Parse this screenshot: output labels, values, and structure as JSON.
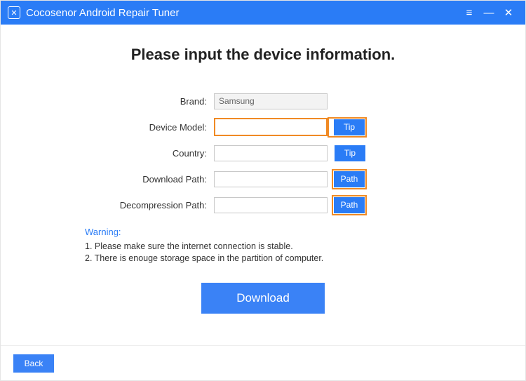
{
  "titlebar": {
    "app_name": "Cocosenor Android Repair Tuner",
    "menu_glyph": "≡",
    "minimize_glyph": "—",
    "close_glyph": "✕",
    "logo_glyph": "✕"
  },
  "page": {
    "heading": "Please input the device information."
  },
  "form": {
    "brand": {
      "label": "Brand:",
      "value": "Samsung"
    },
    "device_model": {
      "label": "Device Model:",
      "value": "",
      "button": "Tip"
    },
    "country": {
      "label": "Country:",
      "value": "",
      "button": "Tip"
    },
    "download_path": {
      "label": "Download Path:",
      "value": "",
      "button": "Path"
    },
    "decompression_path": {
      "label": "Decompression Path:",
      "value": "",
      "button": "Path"
    }
  },
  "warning": {
    "title": "Warning:",
    "line1": "1. Please make sure the internet connection is stable.",
    "line2": "2. There is enouge storage space in the partition of computer."
  },
  "actions": {
    "download": "Download",
    "back": "Back"
  }
}
